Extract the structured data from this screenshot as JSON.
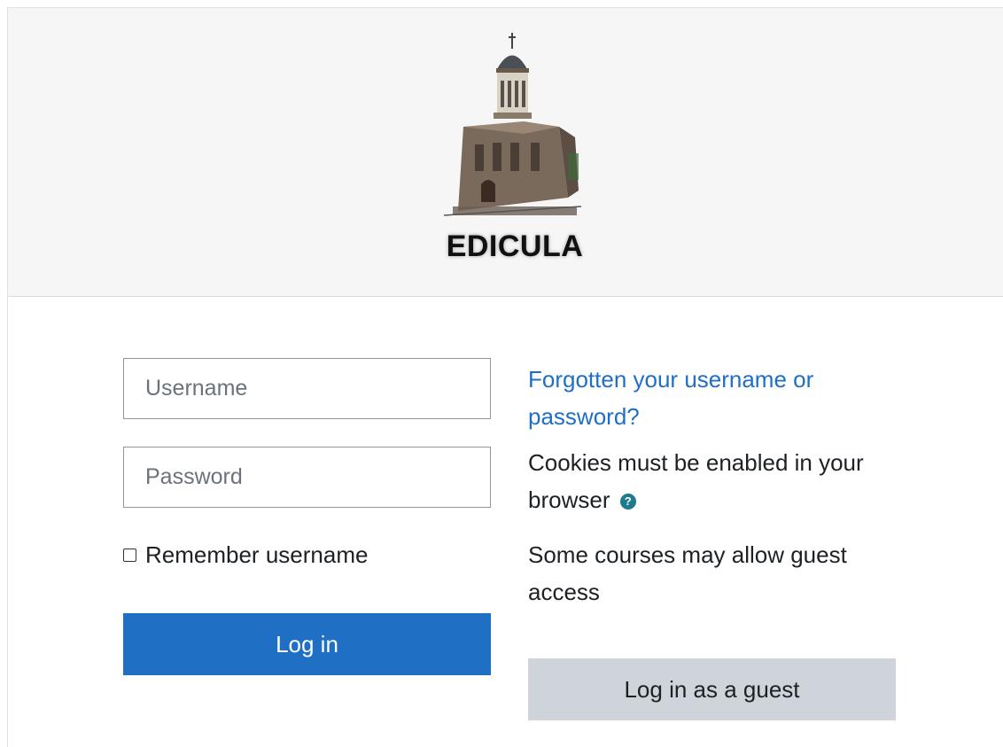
{
  "brand": {
    "logo_text": "EDICULA"
  },
  "login": {
    "username_placeholder": "Username",
    "password_placeholder": "Password",
    "remember_label": "Remember username",
    "login_button": "Log in"
  },
  "info": {
    "forgot_link": "Forgotten your username or password?",
    "cookies_text": "Cookies must be enabled in your browser",
    "help_icon": "question-circle-icon",
    "guest_text": "Some courses may allow guest access",
    "guest_button": "Log in as a guest"
  },
  "colors": {
    "primary": "#1f6fc5",
    "secondary": "#ced4da",
    "header_bg": "#f6f6f6"
  }
}
